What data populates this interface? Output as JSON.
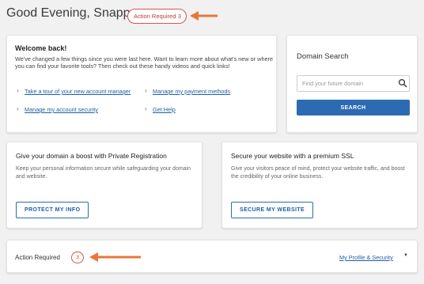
{
  "header": {
    "greeting": "Good Evening, Snappy",
    "action_required_label": "Action Required",
    "action_required_count": "3"
  },
  "welcome": {
    "title": "Welcome back!",
    "body": "We've changed a few things since you were last here. Want to learn more about what's new or where you can find your favorite tools? Then check out these handy videos and quick links!",
    "links": [
      "Take a tour of your new account manager",
      "Manage my payment methods",
      "Manage my account security",
      "Get Help"
    ]
  },
  "domain_search": {
    "title": "Domain Search",
    "placeholder": "Find your future domain",
    "button_label": "SEARCH"
  },
  "promo_private_registration": {
    "title": "Give your domain a boost with Private Registration",
    "body": "Keep your personal information secure while safeguarding your domain and website.",
    "button_label": "PROTECT MY INFO"
  },
  "promo_ssl": {
    "title": "Secure your website with a premium SSL",
    "body": "Give your visitors peace of mind, protect your website traffic, and boost the credibility of your online business.",
    "button_label": "SECURE MY WEBSITE"
  },
  "action_required_panel": {
    "label": "Action Required",
    "count": "3",
    "profile_link": "My Profile & Security"
  },
  "colors": {
    "accent_blue": "#2c6bb3",
    "alert_red": "#d9534f",
    "annotation_arrow": "#e8773a"
  },
  "icons": [
    "search-icon",
    "chevron-right-icon",
    "caret-down-icon",
    "arrow-annotation"
  ]
}
